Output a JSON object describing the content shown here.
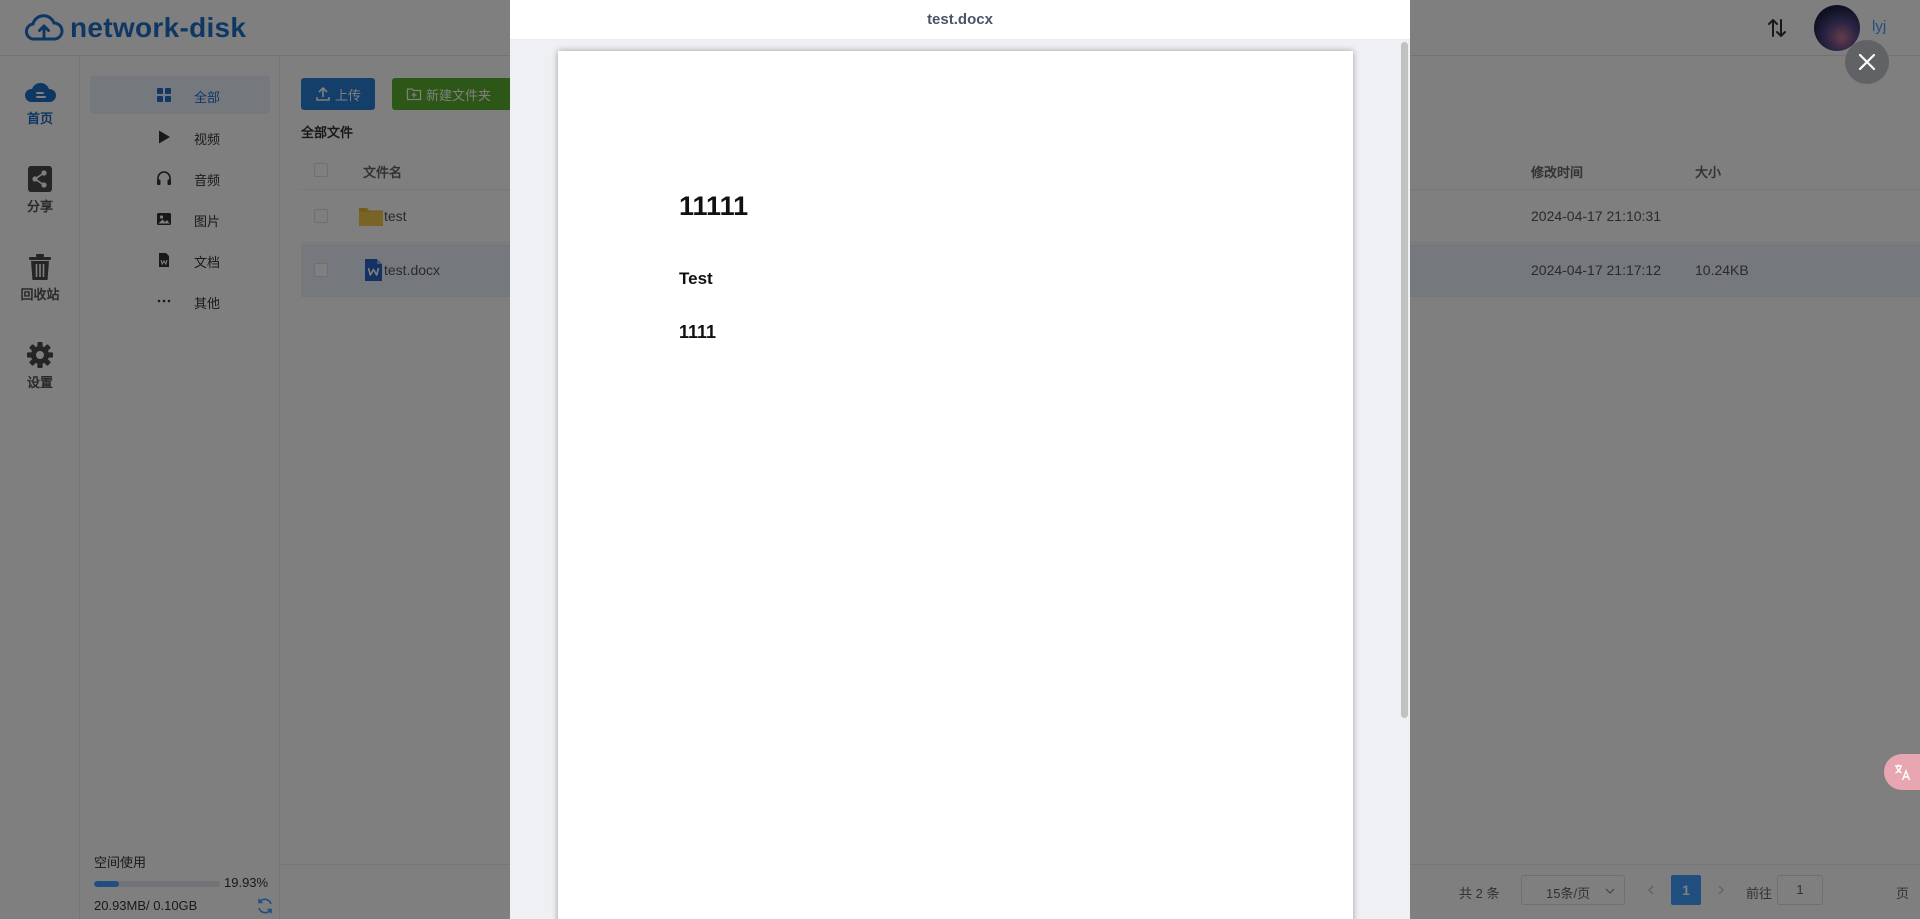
{
  "app": {
    "name": "network-disk",
    "brand_color": "#1f6fc8"
  },
  "header": {
    "username": "lyj",
    "sort_icon": "sort-arrows-icon",
    "avatar": "avatar"
  },
  "leftnav": [
    {
      "label": "首页",
      "icon": "cloud-home-icon",
      "active": true
    },
    {
      "label": "分享",
      "icon": "share-icon",
      "active": false
    },
    {
      "label": "回收站",
      "icon": "trash-icon",
      "active": false
    },
    {
      "label": "设置",
      "icon": "gear-icon",
      "active": false
    }
  ],
  "submenu": [
    {
      "label": "全部",
      "icon": "grid-icon",
      "active": true
    },
    {
      "label": "视频",
      "icon": "play-icon",
      "active": false
    },
    {
      "label": "音频",
      "icon": "headphones-icon",
      "active": false
    },
    {
      "label": "图片",
      "icon": "image-icon",
      "active": false
    },
    {
      "label": "文档",
      "icon": "document-icon",
      "active": false
    },
    {
      "label": "其他",
      "icon": "more-icon",
      "active": false
    }
  ],
  "storage": {
    "label": "空间使用",
    "percent_text": "19.93%",
    "percent": 19.93,
    "usage": "20.93MB/ 0.10GB"
  },
  "toolbar": {
    "upload": "上传",
    "new_folder": "新建文件夹"
  },
  "breadcrumb": "全部文件",
  "table": {
    "columns": {
      "name": "文件名",
      "modified": "修改时间",
      "size": "大小"
    },
    "rows": [
      {
        "name": "test",
        "type": "folder",
        "modified": "2024-04-17 21:10:31",
        "size": "",
        "selected": false
      },
      {
        "name": "test.docx",
        "type": "docx",
        "modified": "2024-04-17 21:17:12",
        "size": "10.24KB",
        "selected": true
      }
    ]
  },
  "pagination": {
    "total": "共 2 条",
    "page_size": "15条/页",
    "current": "1",
    "goto_label": "前往",
    "goto_value": "1",
    "page_suffix": "页"
  },
  "preview": {
    "title": "test.docx",
    "document": {
      "heading": "11111",
      "subheading": "Test",
      "paragraph": "1111"
    }
  },
  "overlay": {
    "close_icon": "close-icon",
    "translate_icon": "translate-icon"
  }
}
